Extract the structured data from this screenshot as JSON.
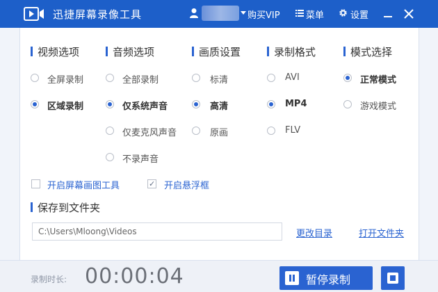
{
  "window": {
    "title": "迅捷屏幕录像工具",
    "buy_vip": "购买VIP",
    "menu": "菜单",
    "settings": "设置"
  },
  "sections": {
    "video": {
      "title": "视频选项",
      "options": [
        "全屏录制",
        "区域录制"
      ],
      "selected": 1
    },
    "audio": {
      "title": "音频选项",
      "options": [
        "全部录制",
        "仅系统声音",
        "仅麦克风声音",
        "不录声音"
      ],
      "selected": 1
    },
    "quality": {
      "title": "画质设置",
      "options": [
        "标清",
        "高清",
        "原画"
      ],
      "selected": 1
    },
    "format": {
      "title": "录制格式",
      "options": [
        "AVI",
        "MP4",
        "FLV"
      ],
      "selected": 1
    },
    "mode": {
      "title": "模式选择",
      "options": [
        "正常模式",
        "游戏模式"
      ],
      "selected": 0
    }
  },
  "checkboxes": {
    "draw_tool": {
      "label": "开启屏幕画图工具",
      "checked": false
    },
    "float_frame": {
      "label": "开启悬浮框",
      "checked": true
    }
  },
  "save": {
    "title": "保存到文件夹",
    "path": "C:\\Users\\Mloong\\Videos",
    "change_dir": "更改目录",
    "open_folder": "打开文件夹"
  },
  "footer": {
    "duration_label": "录制时长:",
    "duration": "00:00:04",
    "pause_label": "暂停录制"
  },
  "colors": {
    "titlebar": "#1d5fc9",
    "accent": "#2a63d1"
  }
}
